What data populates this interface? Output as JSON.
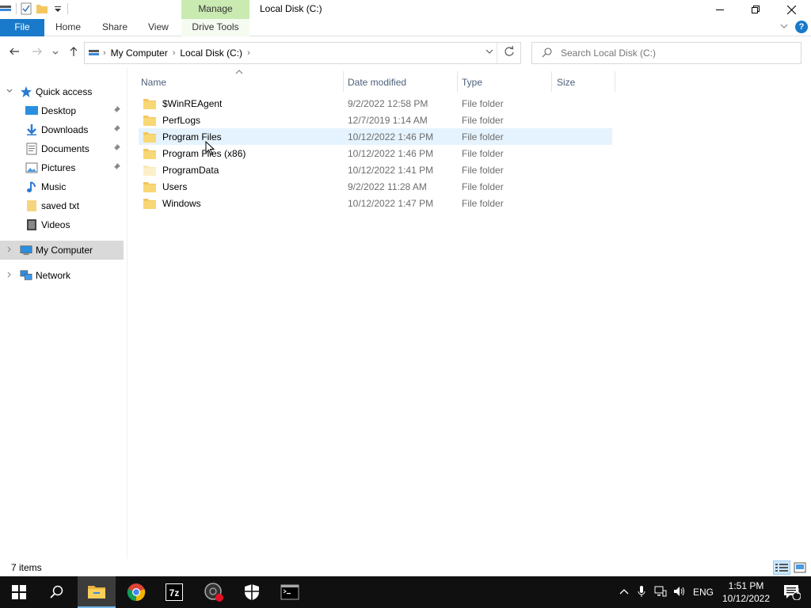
{
  "window": {
    "title": "Local Disk (C:)",
    "context_tab": "Manage",
    "controls": {
      "minimize": "–",
      "maximize": "❐",
      "close": "✕"
    }
  },
  "ribbon": {
    "tabs": [
      "File",
      "Home",
      "Share",
      "View",
      "Drive Tools"
    ],
    "help": "?"
  },
  "address": {
    "crumbs": [
      "My Computer",
      "Local Disk (C:)"
    ],
    "search_placeholder": "Search Local Disk (C:)"
  },
  "navigation": {
    "quick_access": "Quick access",
    "pinned": [
      {
        "label": "Desktop",
        "icon": "desktop-icon",
        "pinned": true
      },
      {
        "label": "Downloads",
        "icon": "download-icon",
        "pinned": true
      },
      {
        "label": "Documents",
        "icon": "documents-icon",
        "pinned": true
      },
      {
        "label": "Pictures",
        "icon": "pictures-icon",
        "pinned": true
      },
      {
        "label": "Music",
        "icon": "music-icon",
        "pinned": false
      },
      {
        "label": "saved txt",
        "icon": "folder-icon",
        "pinned": false
      },
      {
        "label": "Videos",
        "icon": "videos-icon",
        "pinned": false
      }
    ],
    "this_pc": "My Computer",
    "network": "Network"
  },
  "columns": {
    "name": "Name",
    "date": "Date modified",
    "type": "Type",
    "size": "Size"
  },
  "files": [
    {
      "name": "$WinREAgent",
      "date": "9/2/2022 12:58 PM",
      "type": "File folder",
      "size": ""
    },
    {
      "name": "PerfLogs",
      "date": "12/7/2019 1:14 AM",
      "type": "File folder",
      "size": ""
    },
    {
      "name": "Program Files",
      "date": "10/12/2022 1:46 PM",
      "type": "File folder",
      "size": ""
    },
    {
      "name": "Program Files (x86)",
      "date": "10/12/2022 1:46 PM",
      "type": "File folder",
      "size": ""
    },
    {
      "name": "ProgramData",
      "date": "10/12/2022 1:41 PM",
      "type": "File folder",
      "size": ""
    },
    {
      "name": "Users",
      "date": "9/2/2022 11:28 AM",
      "type": "File folder",
      "size": ""
    },
    {
      "name": "Windows",
      "date": "10/12/2022 1:47 PM",
      "type": "File folder",
      "size": ""
    }
  ],
  "status": {
    "items": "7 items"
  },
  "taskbar": {
    "language": "ENG",
    "time": "1:51 PM",
    "date": "10/12/2022",
    "notifications": "1"
  },
  "colors": {
    "accent": "#1979ca",
    "manage_tab": "#c9eab1",
    "folder": "#f3c660",
    "hover_row": "#e5f3ff",
    "selected_nav": "#d9d9d9",
    "taskbar": "#101010"
  }
}
